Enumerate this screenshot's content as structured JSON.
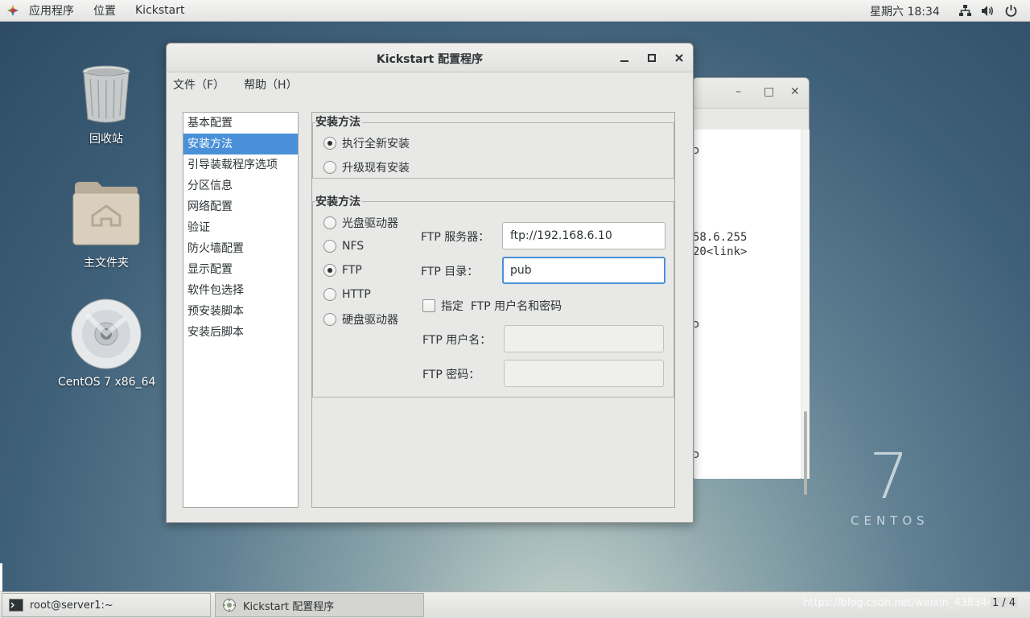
{
  "topbar": {
    "applications": "应用程序",
    "places": "位置",
    "active_app": "Kickstart",
    "clock": "星期六 18:34",
    "icons": [
      "network-icon",
      "volume-icon",
      "power-icon"
    ]
  },
  "desktop": {
    "trash_label": "回收站",
    "home_label": "主文件夹",
    "disc_label": "CentOS 7 x86_64",
    "brand_number": "7",
    "brand_word": "CENTOS"
  },
  "bg_terminal": {
    "line1": "ɔ",
    "line2": "58.6.255",
    "line3": "20<link>",
    "line4": "ɔ",
    "line5": "ɔ"
  },
  "window": {
    "title": "Kickstart 配置程序",
    "menu": {
      "file": "文件（F）",
      "help": "帮助（H）"
    },
    "nav": [
      "基本配置",
      "安装方法",
      "引导装载程序选项",
      "分区信息",
      "网络配置",
      "验证",
      "防火墙配置",
      "显示配置",
      "软件包选择",
      "预安装脚本",
      "安装后脚本"
    ],
    "selected_nav_index": 1,
    "install_frame": {
      "label": "安装方法",
      "options": [
        "执行全新安装",
        "升级现有安装"
      ],
      "selected": 0
    },
    "method_frame": {
      "label": "安装方法",
      "options": [
        "光盘驱动器",
        "NFS",
        "FTP",
        "HTTP",
        "硬盘驱动器"
      ],
      "selected": 2,
      "ftp_server_label": "FTP 服务器：",
      "ftp_server_value": "ftp://192.168.6.10",
      "ftp_dir_label": "FTP 目录：",
      "ftp_dir_value": "pub",
      "auth_checkbox_label": "指定  FTP 用户名和密码",
      "auth_checked": false,
      "ftp_user_label": "FTP 用户名：",
      "ftp_user_value": "",
      "ftp_pass_label": "FTP 密码：",
      "ftp_pass_value": ""
    }
  },
  "taskbar": {
    "terminal_task": "root@server1:~",
    "kickstart_task": "Kickstart 配置程序",
    "watermark": "https://blog.csdn.net/weixin_43834464",
    "pager": "1 / 4"
  },
  "colors": {
    "selection": "#4a90d9",
    "window_bg": "#e8e8e7"
  }
}
